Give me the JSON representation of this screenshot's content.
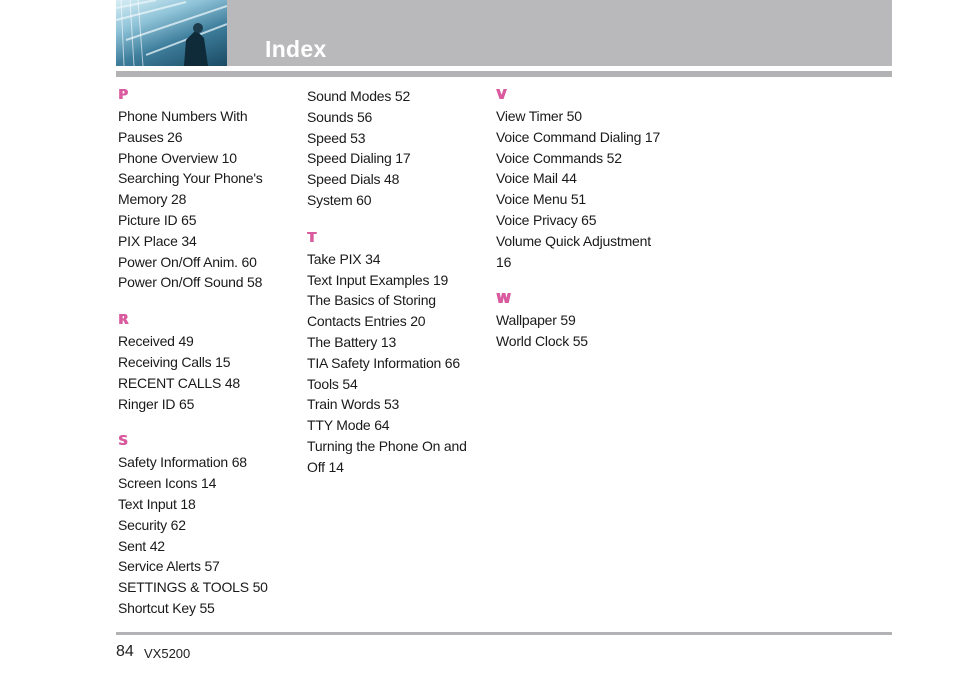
{
  "header": {
    "title": "Index"
  },
  "columns": [
    {
      "sections": [
        {
          "letter": "P",
          "entries": [
            "Phone Numbers With",
            "Pauses 26",
            "Phone Overview 10",
            "Searching Your Phone's",
            "Memory 28",
            "Picture ID 65",
            "PIX Place 34",
            "Power On/Off Anim. 60",
            "Power On/Off Sound 58"
          ]
        },
        {
          "letter": "R",
          "entries": [
            "Received 49",
            "Receiving Calls 15",
            "RECENT CALLS 48",
            "Ringer ID 65"
          ]
        },
        {
          "letter": "S",
          "entries": [
            "Safety Information 68",
            "Screen Icons 14",
            "Text Input 18",
            "Security 62",
            "Sent 42",
            "Service Alerts 57",
            "SETTINGS & TOOLS 50",
            "Shortcut Key 55"
          ]
        }
      ]
    },
    {
      "sections": [
        {
          "letter": "",
          "entries": [
            "Sound Modes 52",
            "Sounds 56",
            "Speed 53",
            "Speed Dialing 17",
            "Speed Dials 48",
            "System 60"
          ]
        },
        {
          "letter": "T",
          "entries": [
            "Take PIX 34",
            "Text Input Examples 19",
            "The Basics of Storing",
            "Contacts Entries 20",
            "The Battery 13",
            "TIA Safety Information 66",
            "Tools 54",
            "Train Words 53",
            "TTY Mode 64",
            "Turning the Phone On and",
            "Off 14"
          ]
        }
      ]
    },
    {
      "sections": [
        {
          "letter": "V",
          "entries": [
            "View Timer 50",
            "Voice Command Dialing 17",
            "Voice Commands 52",
            "Voice Mail 44",
            "Voice Menu 51",
            "Voice Privacy 65",
            "Volume Quick Adjustment",
            "16"
          ]
        },
        {
          "letter": "W",
          "entries": [
            "Wallpaper 59",
            "World Clock 55"
          ]
        }
      ]
    }
  ],
  "footer": {
    "page_number": "84",
    "model": "VX5200"
  },
  "colors": {
    "accent": "#d95a9e",
    "band": "#b9b9bb"
  }
}
